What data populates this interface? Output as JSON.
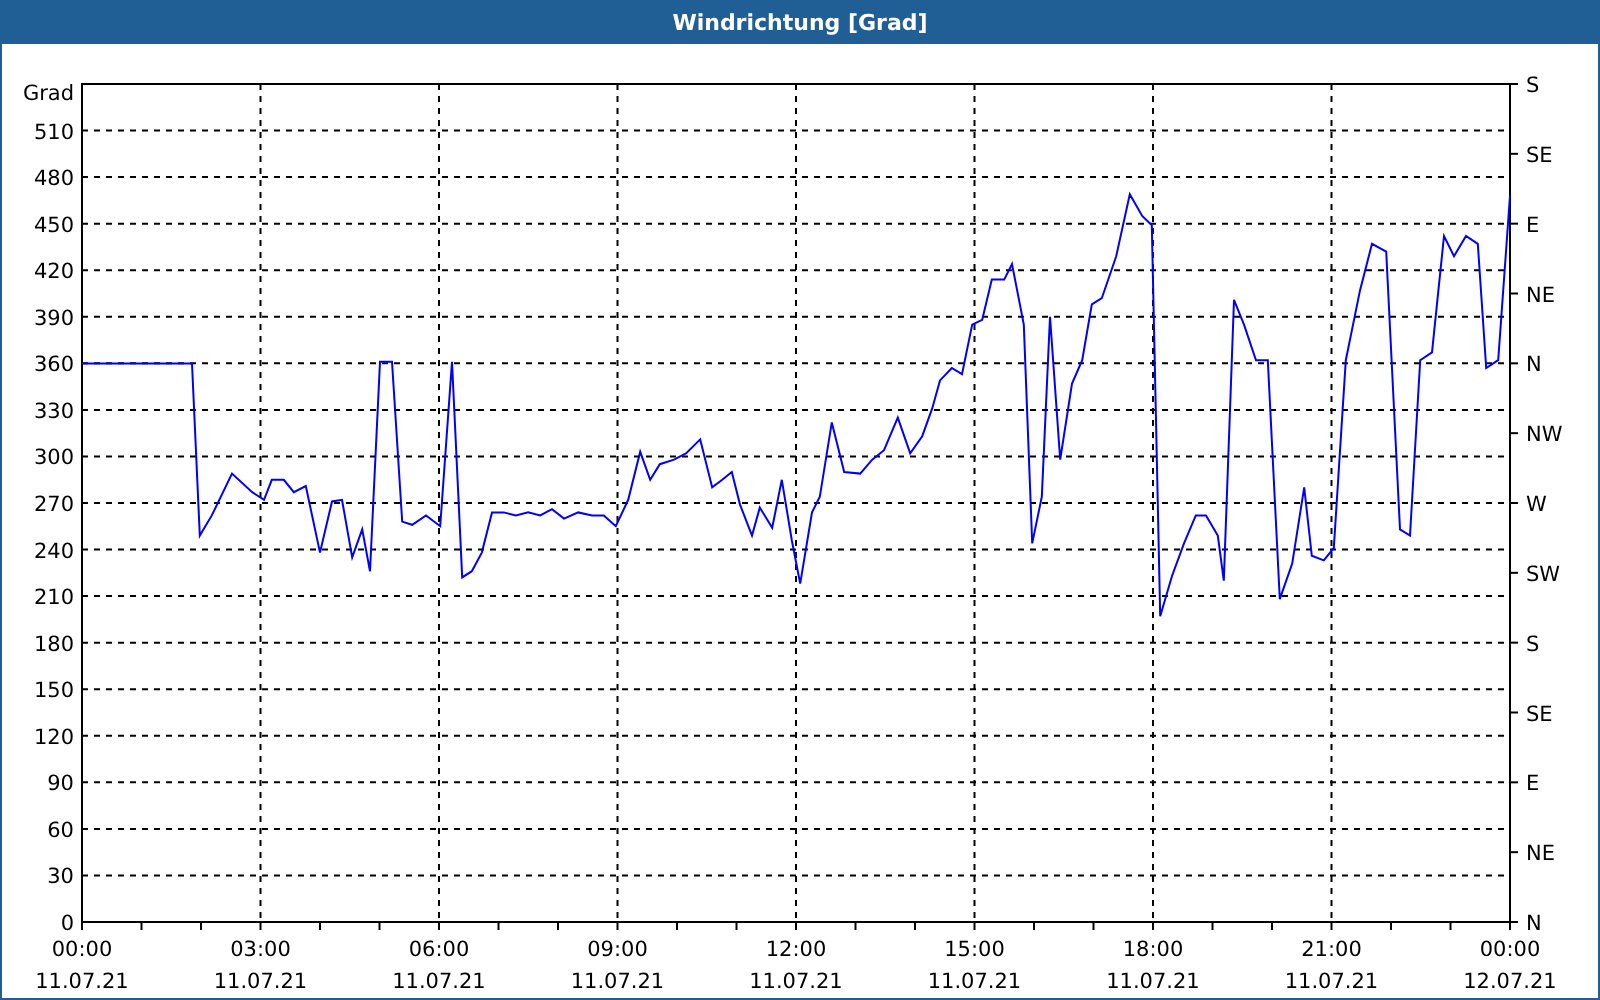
{
  "window": {
    "title": "Windrichtung [Grad]"
  },
  "chart": {
    "right_axis": [
      "S",
      "SE",
      "E",
      "NE",
      "N",
      "NW",
      "W",
      "SW",
      "S",
      "SE",
      "E",
      "NE",
      "N"
    ],
    "xtick_dates": [
      "11.07.21",
      "11.07.21",
      "11.07.21",
      "11.07.21",
      "11.07.21",
      "11.07.21",
      "11.07.21",
      "11.07.21",
      "12.07.21"
    ],
    "chart_data": {
      "type": "line",
      "grid": true,
      "ylabel": "Grad",
      "xlim": [
        0,
        24
      ],
      "ylim": [
        0,
        540
      ],
      "xticks": [
        {
          "value": 0,
          "label": "00:00"
        },
        {
          "value": 3,
          "label": "03:00"
        },
        {
          "value": 6,
          "label": "06:00"
        },
        {
          "value": 9,
          "label": "09:00"
        },
        {
          "value": 12,
          "label": "12:00"
        },
        {
          "value": 15,
          "label": "15:00"
        },
        {
          "value": 18,
          "label": "18:00"
        },
        {
          "value": 21,
          "label": "21:00"
        },
        {
          "value": 24,
          "label": "00:00"
        }
      ],
      "yticks": [
        0,
        30,
        60,
        90,
        120,
        150,
        180,
        210,
        240,
        270,
        300,
        330,
        360,
        390,
        420,
        450,
        480,
        510
      ],
      "x": [
        0,
        1.85,
        1.98,
        2.18,
        2.52,
        2.86,
        3.06,
        3.19,
        3.39,
        3.56,
        3.76,
        4.0,
        4.2,
        4.37,
        4.54,
        4.71,
        4.84,
        5.01,
        5.21,
        5.38,
        5.55,
        5.78,
        6.02,
        6.22,
        6.39,
        6.55,
        6.72,
        6.89,
        7.09,
        7.29,
        7.5,
        7.7,
        7.9,
        8.1,
        8.34,
        8.57,
        8.77,
        8.97,
        9.18,
        9.38,
        9.55,
        9.71,
        9.95,
        10.15,
        10.39,
        10.59,
        10.76,
        10.92,
        11.06,
        11.26,
        11.39,
        11.6,
        11.76,
        11.93,
        12.07,
        12.27,
        12.4,
        12.6,
        12.81,
        13.08,
        13.28,
        13.48,
        13.71,
        13.92,
        14.12,
        14.29,
        14.42,
        14.62,
        14.79,
        14.96,
        15.13,
        15.29,
        15.5,
        15.63,
        15.83,
        15.97,
        16.13,
        16.27,
        16.44,
        16.64,
        16.81,
        16.97,
        17.14,
        17.38,
        17.61,
        17.82,
        17.98,
        18.12,
        18.32,
        18.52,
        18.72,
        18.89,
        19.09,
        19.19,
        19.36,
        19.53,
        19.73,
        19.93,
        20.13,
        20.34,
        20.54,
        20.67,
        20.87,
        21.04,
        21.24,
        21.48,
        21.68,
        21.92,
        22.15,
        22.32,
        22.49,
        22.69,
        22.89,
        23.06,
        23.26,
        23.46,
        23.6,
        23.8,
        24
      ],
      "series": [
        {
          "color": "#0000ff",
          "values": [
            360,
            360,
            249,
            262,
            289,
            277,
            272,
            285,
            285,
            277,
            281,
            238,
            271,
            272,
            235,
            253,
            226,
            361,
            361,
            258,
            256,
            262,
            255,
            361,
            222,
            226,
            238,
            264,
            264,
            262,
            264,
            262,
            266,
            260,
            264,
            262,
            262,
            255,
            272,
            303,
            285,
            295,
            298,
            302,
            311,
            280,
            285,
            290,
            269,
            249,
            267,
            254,
            285,
            246,
            218,
            264,
            274,
            322,
            290,
            289,
            298,
            304,
            325,
            302,
            313,
            331,
            349,
            357,
            353,
            385,
            388,
            414,
            414,
            424,
            385,
            244,
            274,
            390,
            298,
            347,
            362,
            398,
            402,
            429,
            469,
            455,
            449,
            197,
            223,
            244,
            262,
            262,
            249,
            220,
            401,
            385,
            362,
            362,
            208,
            231,
            280,
            236,
            233,
            241,
            362,
            407,
            437,
            432,
            253,
            249,
            362,
            367,
            442,
            429,
            442,
            437,
            357,
            362,
            468
          ]
        }
      ]
    }
  }
}
